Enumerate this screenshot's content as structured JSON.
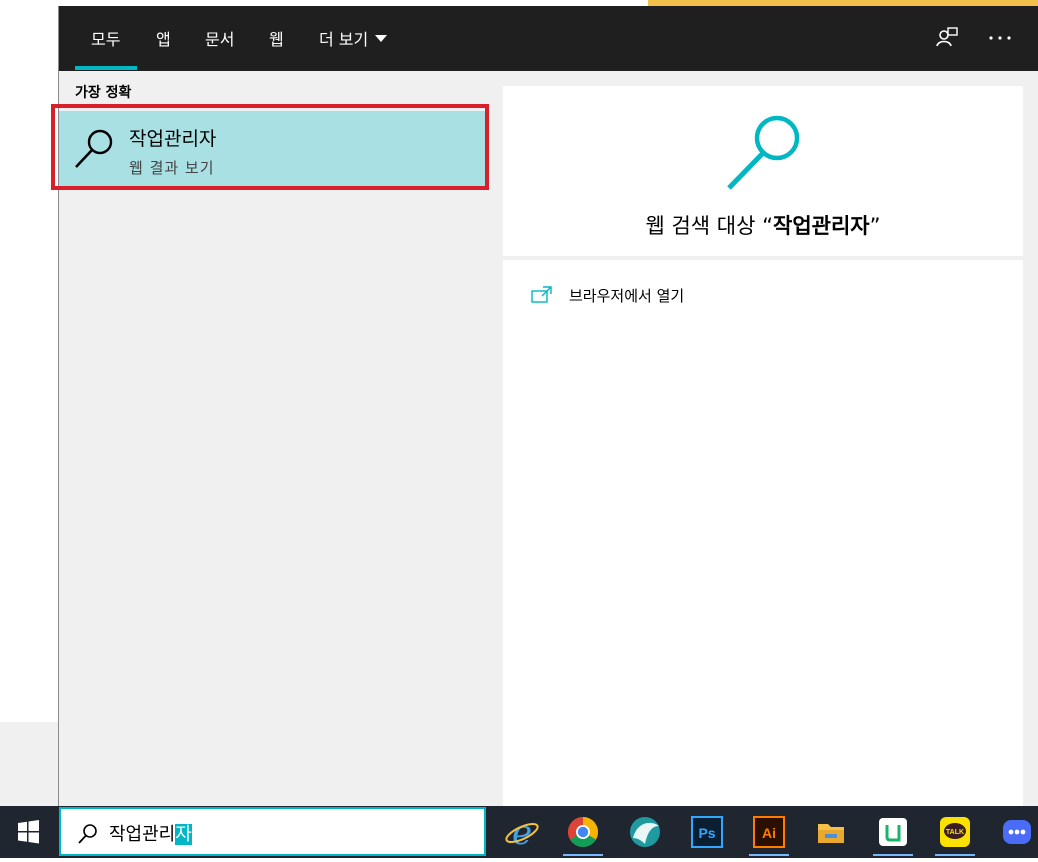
{
  "tabs": [
    {
      "label": "모두",
      "active": true
    },
    {
      "label": "앱"
    },
    {
      "label": "문서"
    },
    {
      "label": "웹"
    },
    {
      "label": "더 보기"
    }
  ],
  "toolbar": {
    "feedback_icon": "feedback-icon",
    "more_icon": "ellipsis-icon"
  },
  "best_match": {
    "section_label": "가장 정확",
    "title": "작업관리자",
    "subtitle": "웹 결과 보기"
  },
  "preview": {
    "prefix": "웹 검색 대상 “",
    "query": "작업관리자",
    "suffix": "”",
    "action_label": "브라우저에서 열기"
  },
  "search": {
    "typed": "작업관리",
    "composing": "자"
  },
  "taskbar": {
    "apps": [
      "internet-explorer-icon",
      "chrome-icon",
      "bird-app-icon",
      "photoshop-icon",
      "illustrator-icon",
      "file-explorer-icon",
      "line-works-icon",
      "kakaotalk-icon",
      "chat-app-icon"
    ],
    "ps_label": "Ps",
    "ai_label": "Ai",
    "talk_label": "TALK"
  },
  "colors": {
    "accent": "#00b7c3",
    "highlight": "#a8e0e3",
    "selection_outline": "#d9202a",
    "topbar": "#1f1f1f",
    "taskbar": "#1f2630"
  }
}
